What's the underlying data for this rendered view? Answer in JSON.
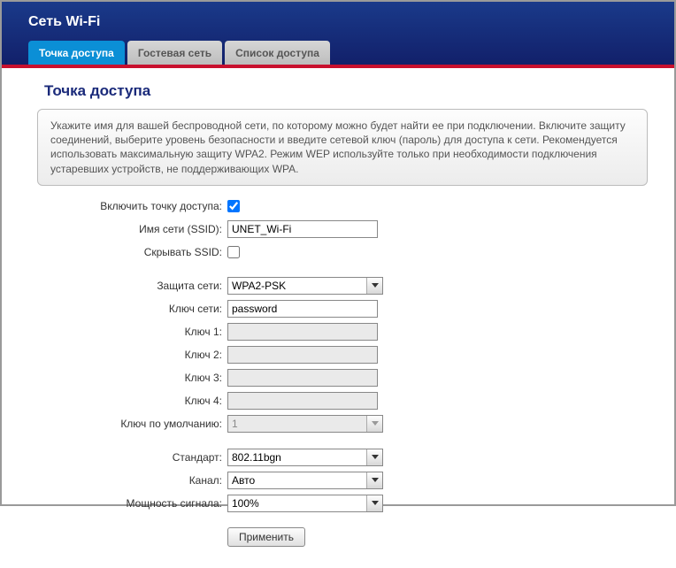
{
  "header": {
    "title": "Сеть Wi-Fi",
    "tabs": [
      {
        "label": "Точка доступа",
        "active": true
      },
      {
        "label": "Гостевая сеть",
        "active": false
      },
      {
        "label": "Список доступа",
        "active": false
      }
    ]
  },
  "section": {
    "title": "Точка доступа",
    "info": "Укажите имя для вашей беспроводной сети, по которому можно будет найти ее при подключении. Включите защиту соединений, выберите уровень безопасности и введите сетевой ключ (пароль) для доступа к сети. Рекомендуется использовать максимальную защиту WPA2. Режим WEP используйте только при необходимости подключения устаревших устройств, не поддерживающих WPA."
  },
  "form": {
    "enable_ap": {
      "label": "Включить точку доступа:",
      "checked": true
    },
    "ssid": {
      "label": "Имя сети (SSID):",
      "value": "UNET_Wi-Fi"
    },
    "hide_ssid": {
      "label": "Скрывать SSID:",
      "checked": false
    },
    "security": {
      "label": "Защита сети:",
      "value": "WPA2-PSK"
    },
    "net_key": {
      "label": "Ключ сети:",
      "value": "password"
    },
    "key1": {
      "label": "Ключ 1:",
      "value": ""
    },
    "key2": {
      "label": "Ключ 2:",
      "value": ""
    },
    "key3": {
      "label": "Ключ 3:",
      "value": ""
    },
    "key4": {
      "label": "Ключ 4:",
      "value": ""
    },
    "default_key": {
      "label": "Ключ по умолчанию:",
      "value": "1"
    },
    "standard": {
      "label": "Стандарт:",
      "value": "802.11bgn"
    },
    "channel": {
      "label": "Канал:",
      "value": "Авто"
    },
    "power": {
      "label": "Мощность сигнала:",
      "value": "100%"
    },
    "apply": "Применить"
  }
}
